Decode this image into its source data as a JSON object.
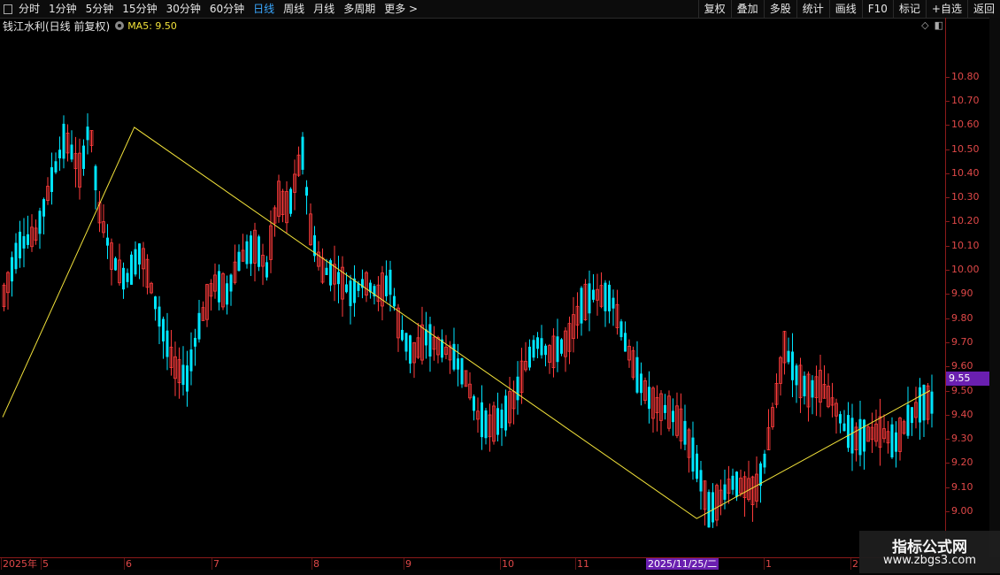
{
  "toolbar": {
    "periods": [
      {
        "label": "分时",
        "active": false
      },
      {
        "label": "1分钟",
        "active": false
      },
      {
        "label": "5分钟",
        "active": false
      },
      {
        "label": "15分钟",
        "active": false
      },
      {
        "label": "30分钟",
        "active": false
      },
      {
        "label": "60分钟",
        "active": false
      },
      {
        "label": "日线",
        "active": true
      },
      {
        "label": "周线",
        "active": false
      },
      {
        "label": "月线",
        "active": false
      },
      {
        "label": "多周期",
        "active": false
      },
      {
        "label": "更多 >",
        "active": false
      }
    ],
    "actions": [
      "复权",
      "叠加",
      "多股",
      "统计",
      "画线",
      "F10",
      "标记",
      "+自选",
      "返回"
    ]
  },
  "info": {
    "stock_title": "钱江水利(日线 前复权)",
    "ma_label": "MA5: 9.50"
  },
  "price_axis": {
    "ticks": [
      "10.80",
      "10.70",
      "10.60",
      "10.50",
      "10.40",
      "10.30",
      "10.20",
      "10.10",
      "10.00",
      "9.90",
      "9.80",
      "9.70",
      "9.60",
      "9.50",
      "9.40",
      "9.30",
      "9.20",
      "9.10",
      "9.00"
    ],
    "current_price": "9.55"
  },
  "date_axis": {
    "labels": [
      "2025年",
      "5",
      "6",
      "7",
      "8",
      "9",
      "10",
      "11",
      "1",
      "2"
    ],
    "highlight": "2025/11/25/二"
  },
  "watermark": {
    "title": "指标公式网",
    "url": "www.zbgs3.com"
  },
  "colors": {
    "up": "#ff3b3b",
    "down": "#00e5ff",
    "ma": "#f2e23a",
    "accent": "#6a1fb0"
  },
  "chart_data": {
    "type": "candlestick",
    "ylim": [
      8.9,
      10.95
    ],
    "trend_line": [
      {
        "date": "2025-04-07",
        "price": 9.39
      },
      {
        "date": "2025-05-21",
        "price": 10.59
      },
      {
        "date": "2025-11-25",
        "price": 8.97
      },
      {
        "date": "2026-02-11",
        "price": 9.5
      }
    ],
    "candles": []
  }
}
